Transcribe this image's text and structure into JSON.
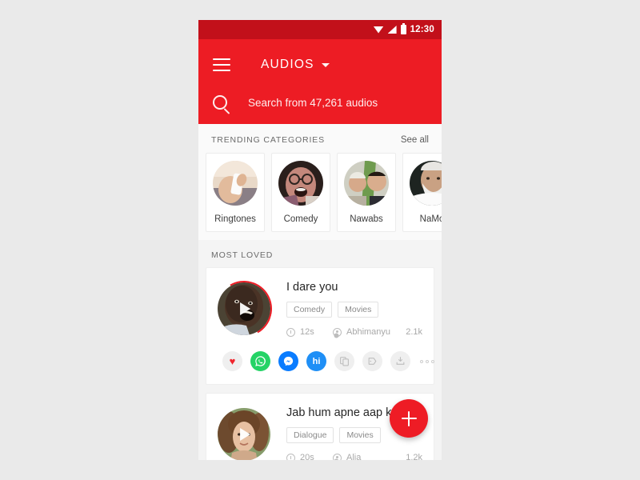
{
  "status_bar": {
    "time": "12:30",
    "icons": [
      "wifi-icon",
      "signal-icon",
      "battery-icon"
    ]
  },
  "app_bar": {
    "menu_icon": "hamburger-menu-icon",
    "title": "AUDIOS",
    "dropdown_icon": "chevron-down-icon"
  },
  "search": {
    "icon": "search-icon",
    "placeholder": "Search from 47,261 audios",
    "value": ""
  },
  "trending": {
    "title": "TRENDING CATEGORIES",
    "see_all": "See all",
    "categories": [
      {
        "label": "Ringtones",
        "image": "hand-holding-phone"
      },
      {
        "label": "Comedy",
        "image": "laughing-man-glasses"
      },
      {
        "label": "Nawabs",
        "image": "two-men-scene"
      },
      {
        "label": "NaMo",
        "image": "older-man-white-beard"
      }
    ]
  },
  "most_loved": {
    "title": "MOST LOVED",
    "cards": [
      {
        "title": "I dare you",
        "tags": [
          "Comedy",
          "Movies"
        ],
        "duration": "12s",
        "author": "Abhimanyu",
        "plays": "2.1k",
        "thumb": "dark-face-shouting",
        "play_icon": "play-icon",
        "progress_ring": true,
        "share": [
          {
            "name": "like-heart-icon",
            "glyph": "♥",
            "style": "sb-like"
          },
          {
            "name": "whatsapp-icon",
            "glyph": "✆",
            "style": "sb-wa"
          },
          {
            "name": "messenger-icon",
            "glyph": "⚡",
            "style": "sb-fb"
          },
          {
            "name": "hike-icon",
            "glyph": "hi",
            "style": "sb-hike"
          },
          {
            "name": "copy-icon",
            "glyph": "",
            "style": "sb-grey"
          },
          {
            "name": "share-tag-icon",
            "glyph": "",
            "style": "sb-grey"
          },
          {
            "name": "download-icon",
            "glyph": "",
            "style": "sb-grey"
          },
          {
            "name": "more-options-icon",
            "glyph": "",
            "style": "more"
          }
        ]
      },
      {
        "title": "Jab hum apne aap ko..",
        "tags": [
          "Dialogue",
          "Movies"
        ],
        "duration": "20s",
        "author": "Alia",
        "plays": "1.2k",
        "thumb": "curly-haired-girl",
        "play_icon": "play-icon",
        "progress_ring": false
      }
    ]
  },
  "fab": {
    "name": "add-audio-fab",
    "icon": "plus-icon"
  },
  "colors": {
    "brand_red": "#ed1c24",
    "status_red": "#c2101a",
    "page_bg": "#eaeaea",
    "card_bg": "#ffffff",
    "whatsapp_green": "#25d366",
    "messenger_blue": "#0a7cff",
    "hike_blue": "#1f8ff6",
    "heart_red": "#f0262e"
  }
}
